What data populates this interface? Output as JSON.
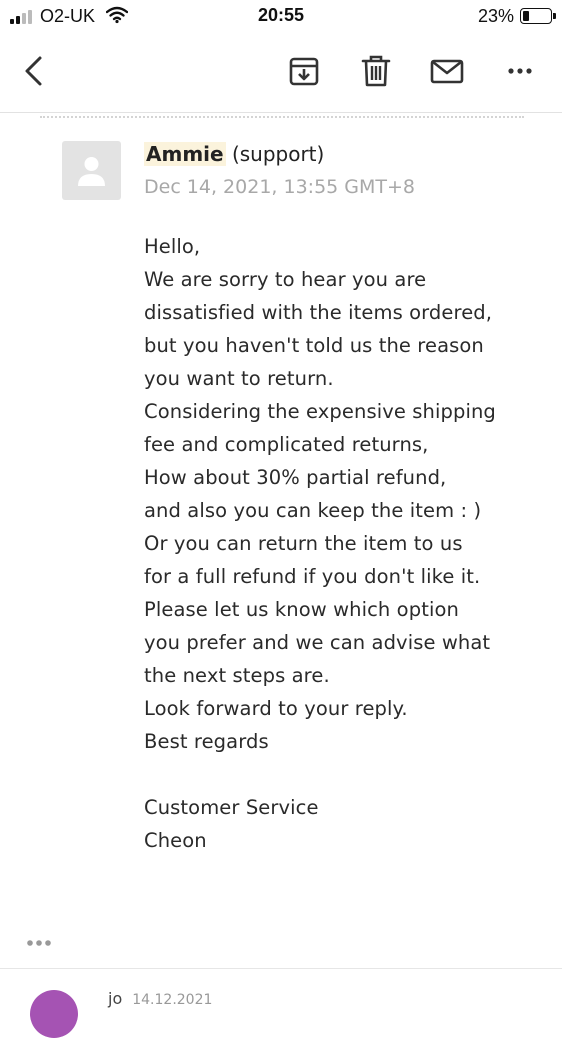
{
  "status_bar": {
    "carrier": "O2-UK",
    "time": "20:55",
    "battery_percent": "23%",
    "battery_level": 0.23
  },
  "toolbar": {
    "back_icon": "chevron-left-icon",
    "archive_icon": "archive-icon",
    "delete_icon": "trash-icon",
    "mark_icon": "envelope-icon",
    "more_icon": "more-horizontal-icon"
  },
  "message": {
    "sender_name": "Ammie",
    "sender_role": "(support)",
    "date": "Dec 14, 2021, 13:55 GMT+8",
    "body_lines": [
      "Hello,",
      "We are sorry to hear you are",
      "dissatisfied with the items ordered,",
      "but you haven't told us the reason",
      "you want to return.",
      "Considering the expensive shipping",
      "fee and complicated returns,",
      "How about 30% partial refund,",
      "and also you can keep the item : )",
      "Or you can return the item to us",
      "for a full refund if you don't like it.",
      "Please let us know which option",
      "you prefer and we can advise what",
      "the next steps are.",
      "Look forward to your reply.",
      "Best regards",
      "",
      "Customer Service",
      "Cheon"
    ]
  },
  "next_message": {
    "sender": "jo",
    "date": "14.12.2021"
  }
}
